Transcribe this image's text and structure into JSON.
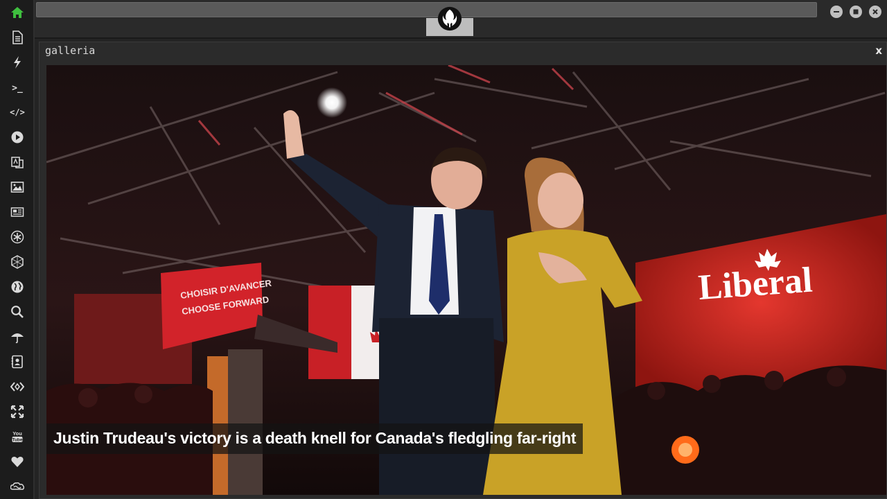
{
  "window": {
    "title": "galleria",
    "close_label": "x"
  },
  "gallery": {
    "caption": "Justin Trudeau's victory is a death knell for Canada's fledgling far-right",
    "sign_text": "Liberal",
    "podium_line1": "CHOISIR D'AVANCER",
    "podium_line2": "CHOOSE FORWARD"
  },
  "sidebar": {
    "items": [
      {
        "icon": "home-icon"
      },
      {
        "icon": "document-icon"
      },
      {
        "icon": "lightning-icon"
      },
      {
        "icon": "terminal-icon",
        "label": ">_"
      },
      {
        "icon": "code-icon",
        "label": "</>"
      },
      {
        "icon": "play-icon"
      },
      {
        "icon": "translate-icon"
      },
      {
        "icon": "image-icon"
      },
      {
        "icon": "newspaper-icon"
      },
      {
        "icon": "asterisk-icon"
      },
      {
        "icon": "hexagon-icon"
      },
      {
        "icon": "globe-icon"
      },
      {
        "icon": "search-icon"
      },
      {
        "icon": "umbrella-icon"
      },
      {
        "icon": "contact-card-icon"
      },
      {
        "icon": "code-diamond-icon"
      },
      {
        "icon": "expand-icon"
      },
      {
        "icon": "youtube-icon",
        "label": "You Tube"
      },
      {
        "icon": "heart-icon"
      },
      {
        "icon": "infinity-cloud-icon"
      }
    ]
  },
  "colors": {
    "sidebar_bg": "#1c1c1c",
    "home_accent": "#3fbf3f",
    "icon": "#d9d9d9",
    "window_bg": "#2b2b2b"
  }
}
